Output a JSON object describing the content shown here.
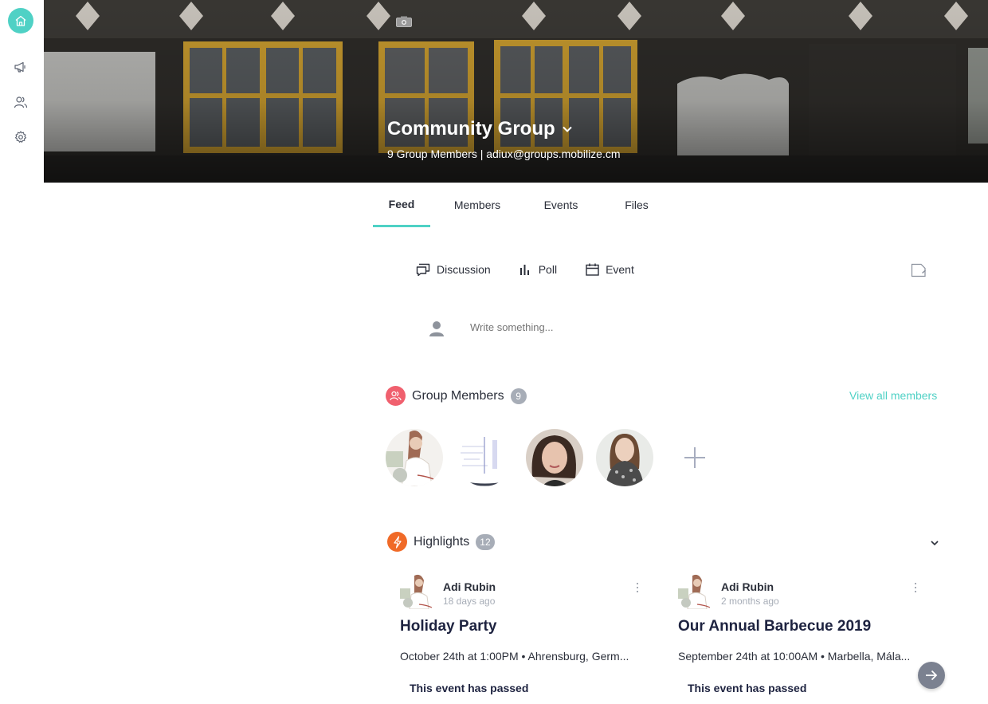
{
  "sidebar": {
    "items": [
      {
        "icon": "home-icon",
        "active": true
      },
      {
        "icon": "megaphone-icon"
      },
      {
        "icon": "people-icon"
      },
      {
        "icon": "gear-icon"
      }
    ],
    "accent": "#4fd1c5"
  },
  "group": {
    "title": "Community Group",
    "subtitle": "9 Group Members | adiux@groups.mobilize.cm"
  },
  "tabs": [
    {
      "label": "Feed",
      "active": true
    },
    {
      "label": "Members"
    },
    {
      "label": "Events"
    },
    {
      "label": "Files"
    }
  ],
  "composer": {
    "types": [
      {
        "label": "Discussion",
        "icon": "discussion-icon"
      },
      {
        "label": "Poll",
        "icon": "poll-icon"
      },
      {
        "label": "Event",
        "icon": "calendar-icon"
      }
    ],
    "placeholder": "Write something..."
  },
  "members": {
    "heading": "Group Members",
    "count": "9",
    "view_all": "View all members"
  },
  "highlights": {
    "heading": "Highlights",
    "count": "12",
    "cards": [
      {
        "author": "Adi Rubin",
        "time": "18 days ago",
        "title": "Holiday Party",
        "meta": "October 24th at 1:00PM • Ahrensburg, Germ...",
        "status": "This event has passed"
      },
      {
        "author": "Adi Rubin",
        "time": "2 months ago",
        "title": "Our Annual Barbecue 2019",
        "meta": "September 24th at 10:00AM • Marbella, Mála...",
        "status": "This event has passed"
      }
    ]
  },
  "colors": {
    "accent": "#4fd1c5",
    "members_badge": "#f0606e",
    "highlights_badge": "#f06a27",
    "count_badge": "#a7adb7"
  }
}
